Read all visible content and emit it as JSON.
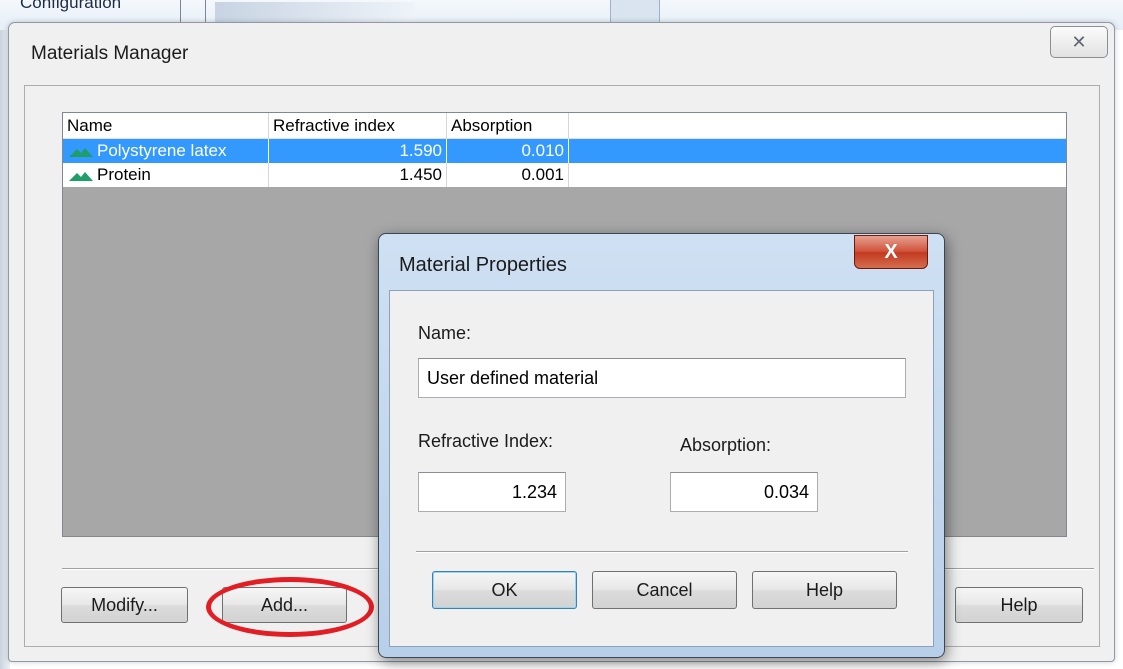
{
  "background": {
    "partial_label": "Configuration"
  },
  "materials_manager": {
    "title": "Materials Manager",
    "close_glyph": "✕",
    "columns": [
      "Name",
      "Refractive index",
      "Absorption"
    ],
    "rows": [
      {
        "name": "Polystyrene latex",
        "refractive_index": "1.590",
        "absorption": "0.010",
        "selected": true
      },
      {
        "name": "Protein",
        "refractive_index": "1.450",
        "absorption": "0.001",
        "selected": false
      }
    ],
    "buttons": {
      "modify": "Modify...",
      "add": "Add...",
      "help": "Help"
    },
    "annotation_color": "#e21d24"
  },
  "material_properties": {
    "title": "Material Properties",
    "close_glyph": "X",
    "name_label": "Name:",
    "name_value": "User defined material",
    "refractive_index_label": "Refractive Index:",
    "refractive_index_value": "1.234",
    "absorption_label": "Absorption:",
    "absorption_value": "0.034",
    "buttons": {
      "ok": "OK",
      "cancel": "Cancel",
      "help": "Help"
    }
  },
  "icons": {
    "material": "material-peak-icon"
  },
  "colors": {
    "selection": "#3399ff",
    "material_icon": "#1f9e6a"
  }
}
